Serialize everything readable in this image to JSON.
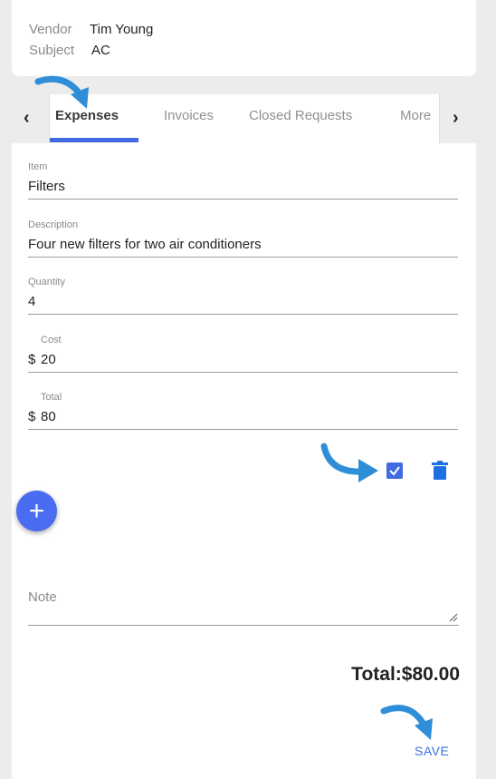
{
  "header": {
    "vendor_label": "Vendor",
    "vendor_value": "Tim Young",
    "subject_label": "Subject",
    "subject_value": "AC"
  },
  "tabs": [
    {
      "label": "Expenses",
      "active": true
    },
    {
      "label": "Invoices",
      "active": false
    },
    {
      "label": "Closed Requests",
      "active": false
    },
    {
      "label": "More",
      "active": false
    }
  ],
  "nav": {
    "prev_icon": "chevron-left-icon",
    "next_icon": "chevron-right-icon"
  },
  "form": {
    "item": {
      "label": "Item",
      "value": "Filters"
    },
    "description": {
      "label": "Description",
      "value": "Four new filters for two air conditioners"
    },
    "quantity": {
      "label": "Quantity",
      "value": "4"
    },
    "cost": {
      "label": "Cost",
      "prefix": "$",
      "value": "20"
    },
    "total": {
      "label": "Total",
      "prefix": "$",
      "value": "80"
    }
  },
  "actions": {
    "confirm_icon": "checkbox-icon",
    "delete_icon": "trash-icon",
    "add_icon": "plus-icon"
  },
  "note": {
    "label": "Note"
  },
  "summary": {
    "total_text": "Total:$80.00"
  },
  "save_label": "SAVE",
  "colors": {
    "accent": "#4169e1",
    "arrow": "#2e8fd8"
  }
}
